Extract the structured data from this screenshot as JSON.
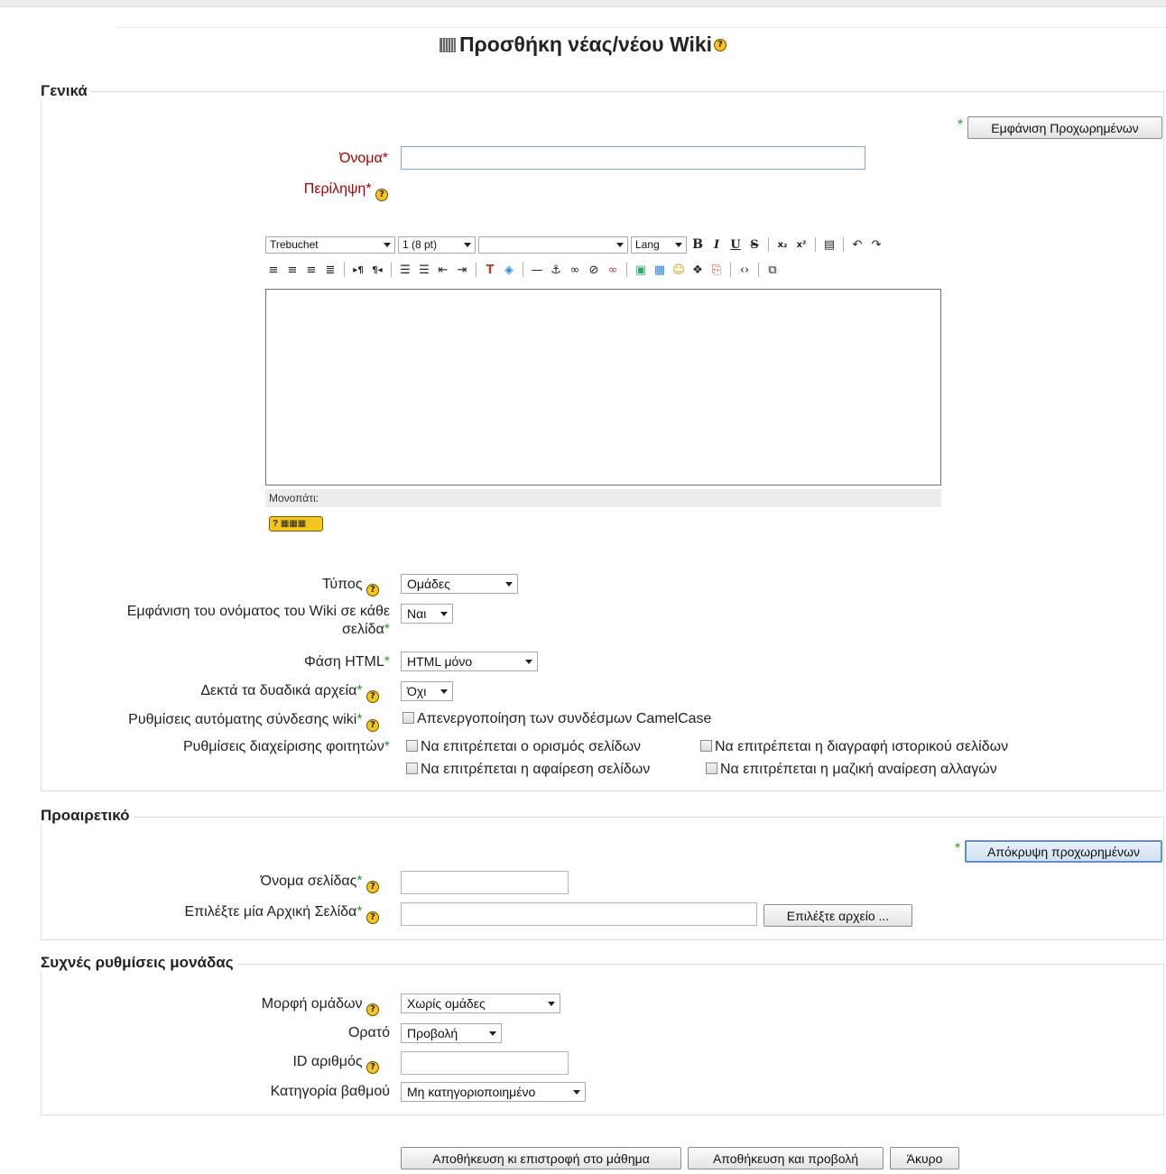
{
  "page": {
    "title": "Προσθήκη νέας/νέου Wiki"
  },
  "general": {
    "legend": "Γενικά",
    "advanced_button": "Εμφάνιση Προχωρημένων",
    "name_label": "Όνομα",
    "name_value": "",
    "summary_label": "Περίληψη",
    "editor": {
      "font": "Trebuchet",
      "size": "1 (8 pt)",
      "style": "",
      "lang": "Lang",
      "path_label": "Μονοπάτι:"
    },
    "type_label": "Τύπος",
    "type_value": "Ομάδες",
    "show_name_label_line1": "Εμφάνιση του ονόματος του Wiki σε κάθε",
    "show_name_label_line2": "σελίδα",
    "show_name_value": "Ναι",
    "html_mode_label": "Φάση HTML",
    "html_mode_value": "HTML μόνο",
    "binary_label": "Δεκτά τα δυαδικά αρχεία",
    "binary_value": "Όχι",
    "autolink_label": "Ρυθμίσεις αυτόματης σύνδεσης wiki",
    "autolink_option": "Απενεργοποίηση των συνδέσμων CamelCase",
    "student_admin_label": "Ρυθμίσεις διαχείρισης φοιτητών",
    "student_options": [
      "Να επιτρέπεται ο ορισμός σελίδων",
      "Να επιτρέπεται η διαγραφή ιστορικού σελίδων",
      "Να επιτρέπεται η αφαίρεση σελίδων",
      "Να επιτρέπεται η μαζική αναίρεση αλλαγών"
    ]
  },
  "optional": {
    "legend": "Προαιρετικό",
    "advanced_button": "Απόκρυψη προχωρημένων",
    "page_name_label": "Όνομα σελίδας",
    "page_name_value": "",
    "initial_page_label": "Επιλέξτε μία Αρχική Σελίδα",
    "initial_page_value": "",
    "choose_file_button": "Επιλέξτε αρχείο ..."
  },
  "common": {
    "legend": "Συχνές ρυθμίσεις μονάδας",
    "group_mode_label": "Μορφή ομάδων",
    "group_mode_value": "Χωρίς ομάδες",
    "visible_label": "Ορατό",
    "visible_value": "Προβολή",
    "id_label": "ID αριθμός",
    "id_value": "",
    "grade_cat_label": "Κατηγορία βαθμού",
    "grade_cat_value": "Μη κατηγοριοποιημένο"
  },
  "actions": {
    "save_return": "Αποθήκευση κι επιστροφή στο μάθημα",
    "save_display": "Αποθήκευση και προβολή",
    "cancel": "Άκυρο"
  },
  "glyphs": {
    "star": "*",
    "help": "?"
  }
}
